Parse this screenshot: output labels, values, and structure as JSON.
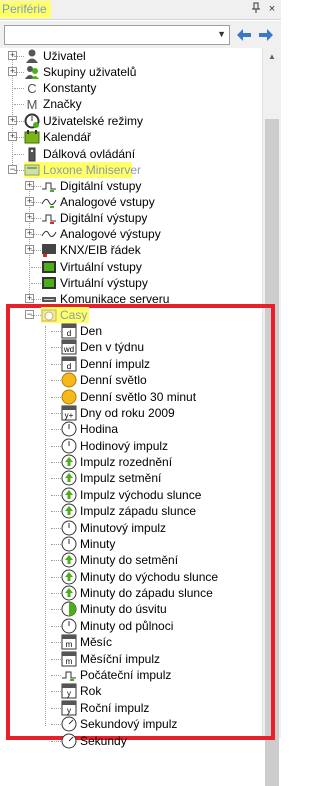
{
  "panel": {
    "title": "Periférie",
    "pin_icon": "pin-icon",
    "close_label": "×"
  },
  "toolbar": {
    "combo_value": "",
    "back_icon": "arrow-left-icon",
    "forward_icon": "arrow-right-icon"
  },
  "tree": {
    "items": [
      {
        "label": "Uživatel",
        "icon": "user-icon"
      },
      {
        "label": "Skupiny uživatelů",
        "icon": "user-group-icon"
      },
      {
        "label": "Konstanty",
        "icon": "constant-icon"
      },
      {
        "label": "Značky",
        "icon": "marker-icon"
      },
      {
        "label": "Uživatelské režimy",
        "icon": "mode-icon"
      },
      {
        "label": "Kalendář",
        "icon": "calendar-icon"
      },
      {
        "label": "Dálková ovládání",
        "icon": "remote-icon"
      },
      {
        "label": "Loxone Miniserver",
        "icon": "miniserver-icon"
      },
      {
        "label": "Digitální vstupy",
        "icon": "digital-input-icon"
      },
      {
        "label": "Analogové vstupy",
        "icon": "analog-input-icon"
      },
      {
        "label": "Digitální výstupy",
        "icon": "digital-output-icon"
      },
      {
        "label": "Analogové výstupy",
        "icon": "analog-output-icon"
      },
      {
        "label": "KNX/EIB řádek",
        "icon": "knx-icon"
      },
      {
        "label": "Virtuální vstupy",
        "icon": "virtual-input-icon"
      },
      {
        "label": "Virtuální výstupy",
        "icon": "virtual-output-icon"
      },
      {
        "label": "Komunikace serveru",
        "icon": "server-communication-icon"
      },
      {
        "label": "Casy",
        "icon": "clock-folder-icon"
      },
      {
        "label": "Den",
        "icon": "day-icon"
      },
      {
        "label": "Den v týdnu",
        "icon": "weekday-icon"
      },
      {
        "label": "Denní impulz",
        "icon": "daily-pulse-icon"
      },
      {
        "label": "Denní světlo",
        "icon": "daylight-icon"
      },
      {
        "label": "Denní světlo 30 minut",
        "icon": "daylight-30-icon"
      },
      {
        "label": "Dny od roku 2009",
        "icon": "days-since-icon"
      },
      {
        "label": "Hodina",
        "icon": "hour-icon"
      },
      {
        "label": "Hodinový impulz",
        "icon": "hour-pulse-icon"
      },
      {
        "label": "Impulz rozednění",
        "icon": "dawn-pulse-icon"
      },
      {
        "label": "Impulz setmění",
        "icon": "dusk-pulse-icon"
      },
      {
        "label": "Impulz východu slunce",
        "icon": "sunrise-pulse-icon"
      },
      {
        "label": "Impulz západu slunce",
        "icon": "sunset-pulse-icon"
      },
      {
        "label": "Minutový impulz",
        "icon": "minute-pulse-icon"
      },
      {
        "label": "Minuty",
        "icon": "minutes-icon"
      },
      {
        "label": "Minuty do setmění",
        "icon": "minutes-to-dusk-icon"
      },
      {
        "label": "Minuty do východu slunce",
        "icon": "minutes-to-sunrise-icon"
      },
      {
        "label": "Minuty do západu slunce",
        "icon": "minutes-to-sunset-icon"
      },
      {
        "label": "Minuty do úsvitu",
        "icon": "minutes-to-dawn-icon"
      },
      {
        "label": "Minuty od půlnoci",
        "icon": "minutes-since-midnight-icon"
      },
      {
        "label": "Měsíc",
        "icon": "month-icon"
      },
      {
        "label": "Měsíční impulz",
        "icon": "month-pulse-icon"
      },
      {
        "label": "Počáteční impulz",
        "icon": "start-pulse-icon"
      },
      {
        "label": "Rok",
        "icon": "year-icon"
      },
      {
        "label": "Roční impulz",
        "icon": "year-pulse-icon"
      },
      {
        "label": "Sekundový impulz",
        "icon": "second-pulse-icon"
      },
      {
        "label": "Sekundy",
        "icon": "seconds-icon"
      }
    ],
    "icon_glyphs": {
      "C": "C",
      "M": "M",
      "wd": "wd",
      "d": "d",
      "y+": "y+",
      "m": "m",
      "y": "y",
      "minus": "−",
      "plus": "+"
    }
  },
  "colors": {
    "highlight": "#ffff66",
    "box": "#e8202a",
    "accent": "#3a78c9"
  }
}
